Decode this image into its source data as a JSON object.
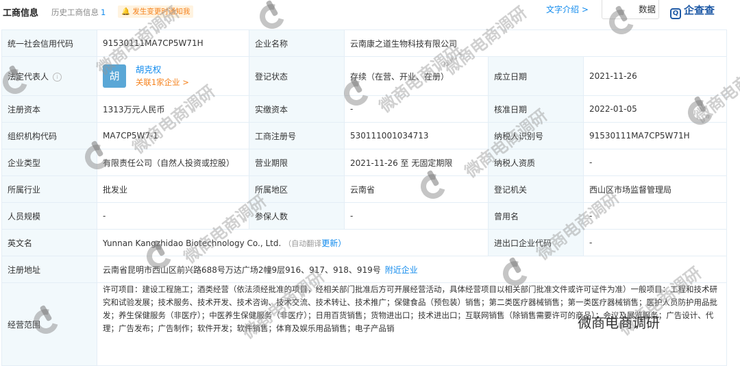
{
  "header": {
    "tab_active": "工商信息",
    "tab_history": "历史工商信息",
    "tab_history_count": "1",
    "notify_label": "发生变更时通知我",
    "intro_link": "文字介绍 >",
    "data_button": "数据",
    "brand": "企查查",
    "brand_icon": "Q"
  },
  "rows": {
    "credit_code_label": "统一社会信用代码",
    "credit_code": "91530111MA7CP5W71H",
    "company_name_label": "企业名称",
    "company_name": "云南康之道生物科技有限公司",
    "legal_rep_label": "法定代表人",
    "legal_rep_avatar": "胡",
    "legal_rep_name": "胡克权",
    "legal_rep_related": "关联1家企业 >",
    "reg_status_label": "登记状态",
    "reg_status": "存续（在营、开业、在册）",
    "est_date_label": "成立日期",
    "est_date": "2021-11-26",
    "reg_capital_label": "注册资本",
    "reg_capital": "1313万元人民币",
    "paid_capital_label": "实缴资本",
    "paid_capital": "-",
    "approve_date_label": "核准日期",
    "approve_date": "2022-01-05",
    "org_code_label": "组织机构代码",
    "org_code": "MA7CP5W7-1",
    "biz_reg_no_label": "工商注册号",
    "biz_reg_no": "530111001034713",
    "taxpayer_id_label": "纳税人识别号",
    "taxpayer_id": "91530111MA7CP5W71H",
    "company_type_label": "企业类型",
    "company_type": "有限责任公司（自然人投资或控股）",
    "term_label": "营业期限",
    "term": "2021-11-26 至 无固定期限",
    "taxpayer_qual_label": "纳税人资质",
    "taxpayer_qual": "-",
    "industry_label": "所属行业",
    "industry": "批发业",
    "region_label": "所属地区",
    "region": "云南省",
    "reg_authority_label": "登记机关",
    "reg_authority": "西山区市场监督管理局",
    "staff_label": "人员规模",
    "staff": "-",
    "insured_label": "参保人数",
    "insured": "-",
    "former_name_label": "曾用名",
    "former_name": "-",
    "english_label": "英文名",
    "english": "Yunnan Kangzhidao Biotechnology Co., Ltd.",
    "english_hint": "（自动翻译",
    "english_more": "更新）",
    "import_export_label": "进出口企业代码",
    "import_export": "-",
    "address_label": "注册地址",
    "address": "云南省昆明市西山区前兴路688号万达广场2幢9层916、917、918、919号",
    "address_link": "附近企业",
    "scope_label": "经营范围",
    "scope": "许可项目：建设工程施工；酒类经营（依法须经批准的项目，经相关部门批准后方可开展经营活动，具体经营项目以相关部门批准文件或许可证件为准）一般项目：工程和技术研究和试验发展；技术服务、技术开发、技术咨询、技术交流、技术转让、技术推广；保健食品（预包装）销售；第二类医疗器械销售；第一类医疗器械销售；医护人员防护用品批发；养生保健服务（非医疗）；中医养生保健服务（非医疗）；日用百货销售；货物进出口；技术进出口；互联网销售（除销售需要许可的商品）；会议及展览服务；广告设计、代理；广告发布；广告制作；软件开发；软件销售；体育及娱乐用品销售；电子产品销"
  },
  "watermark": {
    "text": "微商电商调研"
  }
}
